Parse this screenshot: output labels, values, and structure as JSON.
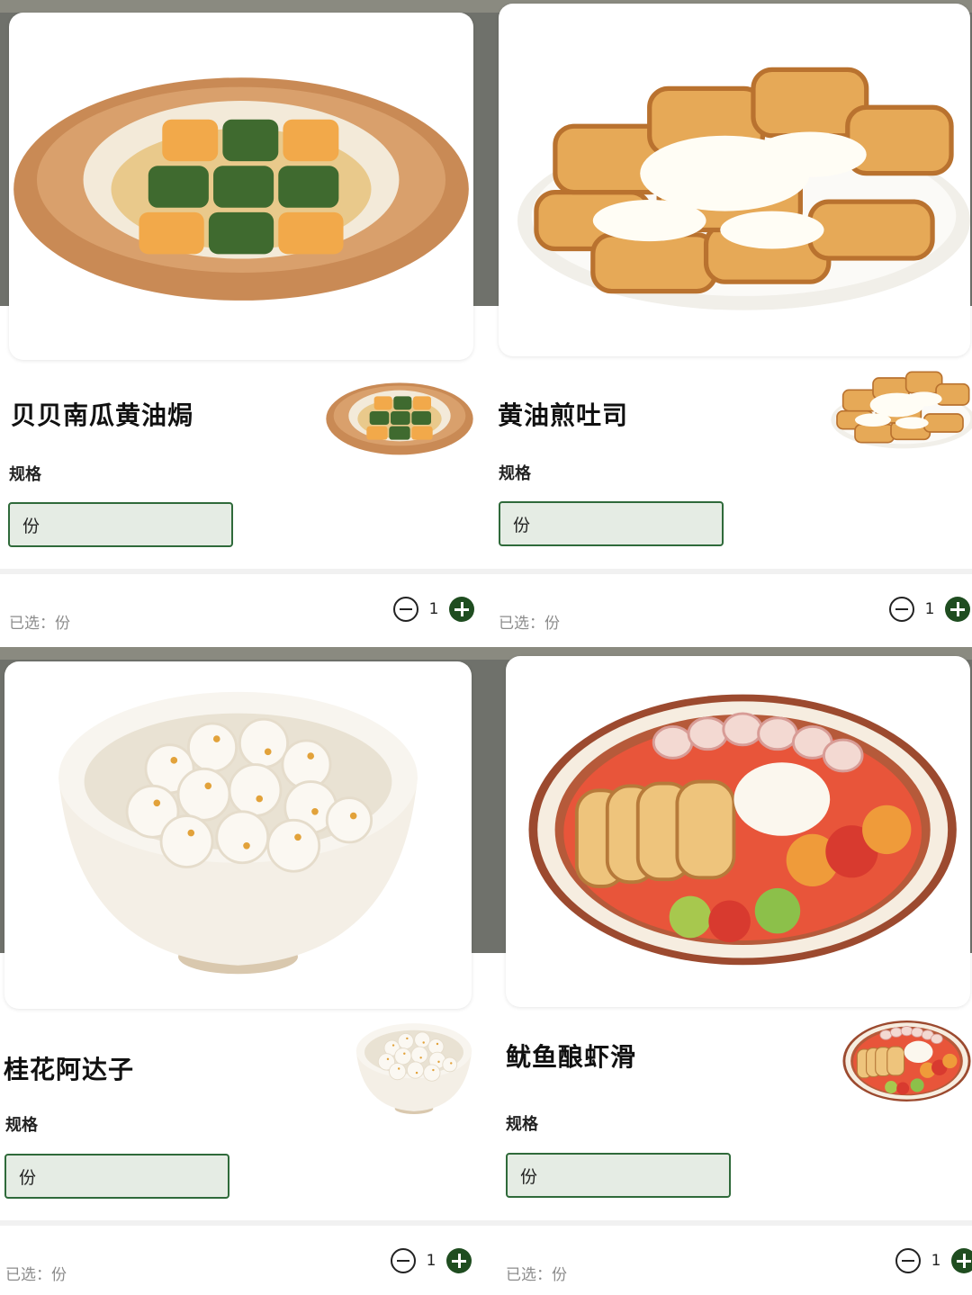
{
  "items": [
    {
      "title": "贝贝南瓜黄油焗",
      "spec_label": "规格",
      "spec_option": "份",
      "selected": "已选：份",
      "quantity": "1",
      "image_icon": "pumpkin-claypot-photo"
    },
    {
      "title": "黄油煎吐司",
      "spec_label": "规格",
      "spec_option": "份",
      "selected": "已选：份",
      "quantity": "1",
      "image_icon": "butter-toast-photo"
    },
    {
      "title": "桂花阿达子",
      "spec_label": "规格",
      "spec_option": "份",
      "selected": "已选：份",
      "quantity": "1",
      "image_icon": "osmanthus-dessert-bowl-photo"
    },
    {
      "title": "鱿鱼酿虾滑",
      "spec_label": "规格",
      "spec_option": "份",
      "selected": "已选：份",
      "quantity": "1",
      "image_icon": "squid-shrimp-platter-photo"
    }
  ],
  "colors": {
    "accent_green": "#1f4d20",
    "option_border": "#2f6a3a",
    "option_fill": "#e5ece4",
    "muted_text": "#8c8c8c"
  }
}
